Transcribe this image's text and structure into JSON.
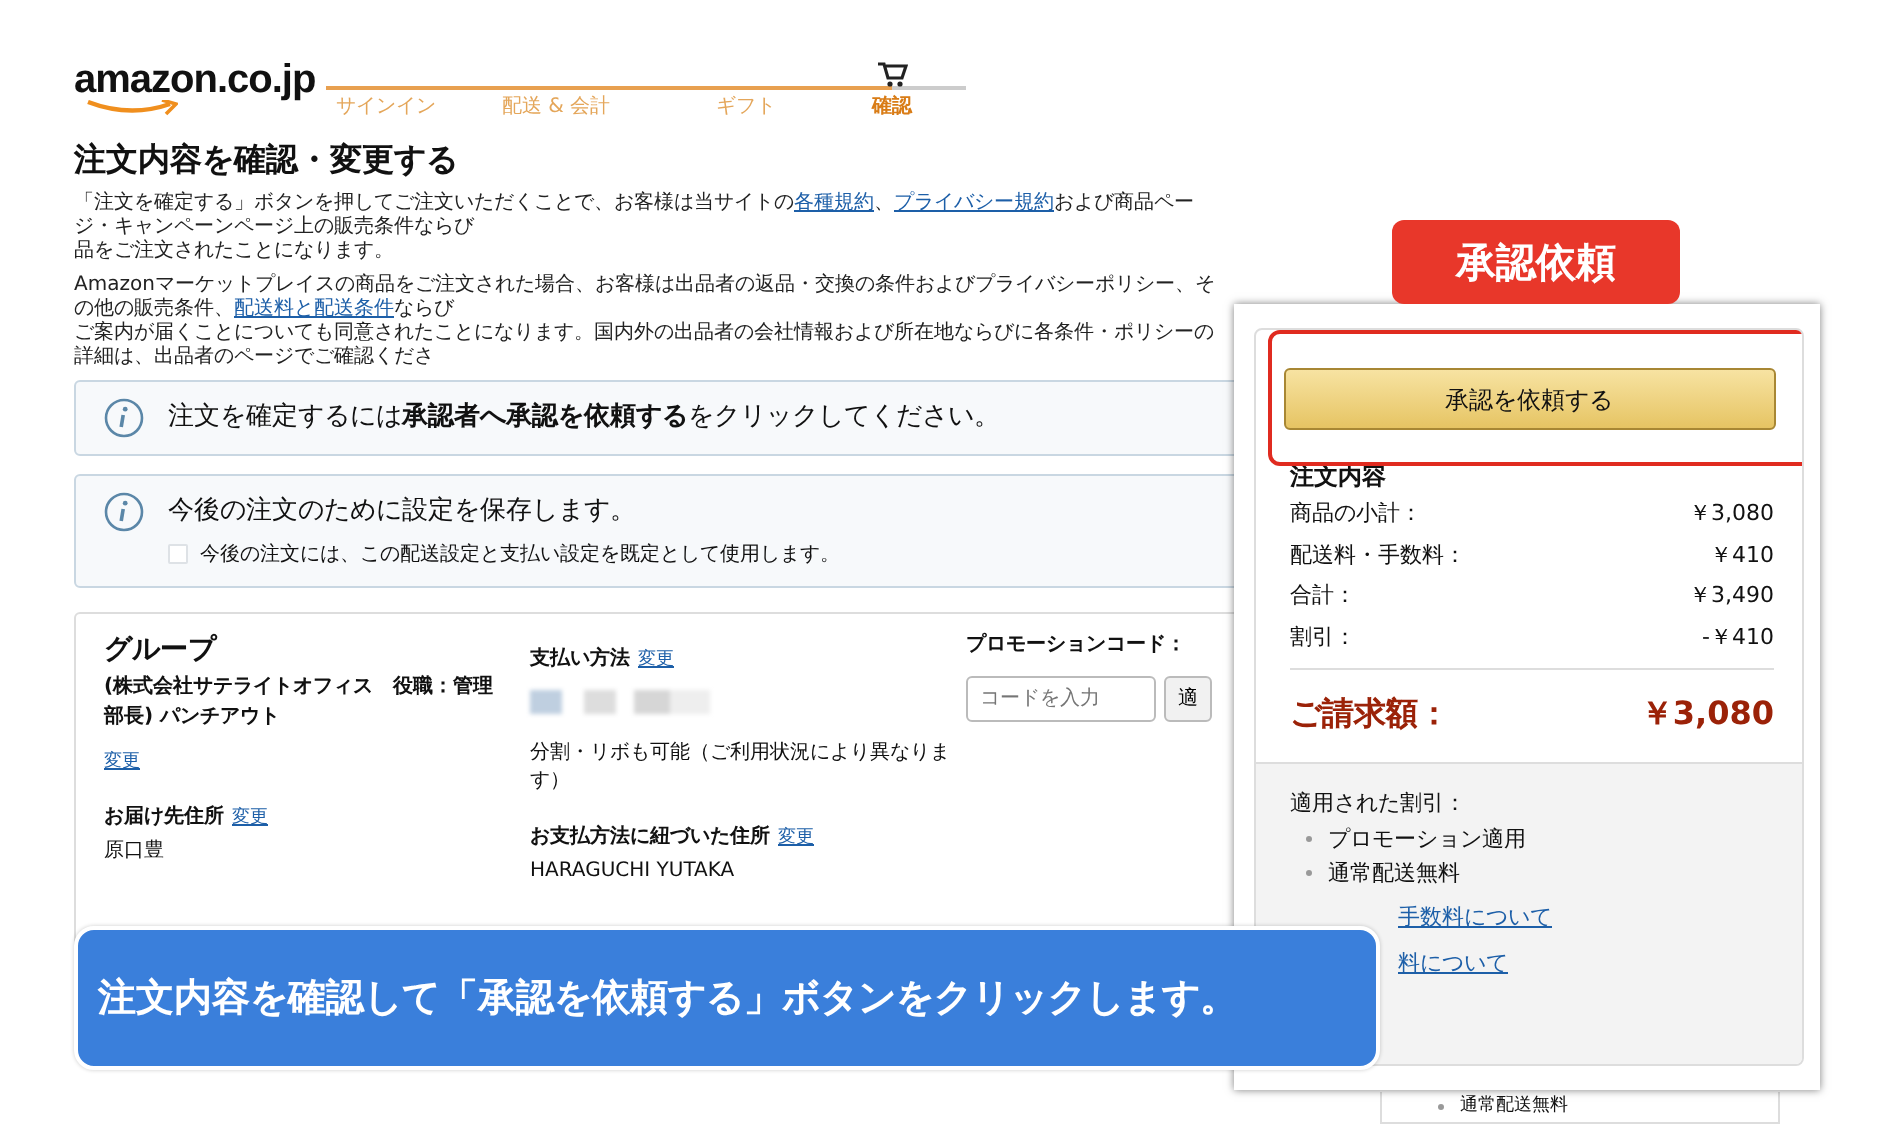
{
  "header": {
    "logo": "amazon.co.jp",
    "steps": [
      {
        "label": "サインイン",
        "selected": false
      },
      {
        "label": "配送 & 会計",
        "selected": false
      },
      {
        "label": "ギフト",
        "selected": false
      },
      {
        "label": "確認",
        "selected": true
      }
    ]
  },
  "title": "注文内容を確認・変更する",
  "notice_paragraphs": [
    {
      "fragments": [
        [
          {
            "kind": "text",
            "text": "「注文を確定する」ボタンを押してご注文いただくことで、お客様は当サイトの"
          },
          {
            "kind": "link",
            "text": "各種規約"
          },
          {
            "kind": "text",
            "text": "、"
          },
          {
            "kind": "link",
            "text": "プライバシー規約"
          },
          {
            "kind": "text",
            "text": "および商品ページ・キャンペーンページ上の販売条件ならび"
          }
        ],
        [
          {
            "kind": "text",
            "text": "品をご注文されたことになります。"
          }
        ]
      ]
    },
    {
      "fragments": [
        [
          {
            "kind": "text",
            "text": "Amazonマーケットプレイスの商品をご注文された場合、お客様は出品者の返品・交換の条件およびプライバシーポリシー、その他の販売条件、"
          },
          {
            "kind": "link",
            "text": "配送料と配送条件"
          },
          {
            "kind": "text",
            "text": "ならび"
          }
        ],
        [
          {
            "kind": "text",
            "text": "ご案内が届くことについても同意されたことになります。国内外の出品者の会社情報および所在地ならびに各条件・ポリシーの詳細は、出品者のページでご確認くださ"
          }
        ]
      ]
    }
  ],
  "info_boxes": [
    {
      "text": "注文を確定するには**承認者へ承認を依頼する**をクリックしてください。"
    },
    {
      "text": "今後の注文のために設定を保存します。",
      "checkbox": {
        "label": "今後の注文には、この配送設定と支払い設定を既定として使用します。",
        "checked": false
      }
    }
  ],
  "order": {
    "group": {
      "heading": "グループ",
      "name": "(株式会社サテライトオフィス　役職：管理部長) パンチアウト",
      "change_link": "変更"
    },
    "shipping_address": {
      "heading": "お届け先住所",
      "change_link": "変更",
      "value": "原口豊"
    },
    "payment": {
      "heading": "支払い方法",
      "change_link": "変更",
      "note": "分割・リボも可能（ご利用状況により異なります）"
    },
    "billing_address": {
      "heading": "お支払方法に紐づいた住所",
      "change_link": "変更",
      "value": "HARAGUCHI YUTAKA"
    },
    "promotion": {
      "heading": "プロモーションコード：",
      "placeholder": "コードを入力",
      "button": "適"
    }
  },
  "summary": {
    "button": "承認を依頼する",
    "heading": "注文内容",
    "rows": [
      {
        "label": "商品の小計：",
        "value": "￥3,080"
      },
      {
        "label": "配送料・手数料：",
        "value": "￥410"
      },
      {
        "label": "合計：",
        "value": "￥3,490"
      },
      {
        "label": "割引：",
        "value": "-￥410"
      }
    ],
    "total": {
      "label": "ご請求額：",
      "value": "￥3,080"
    },
    "discounts": {
      "heading": "適用された割引：",
      "items": [
        "プロモーション適用",
        "通常配送無料"
      ]
    },
    "links": [
      "手数料について",
      "料について"
    ]
  },
  "behind_panel_item": "通常配送無料",
  "callout_label": "承認依頼",
  "instruction_banner": "注文内容を確認して「承認を依頼する」ボタンをクリックします。"
}
